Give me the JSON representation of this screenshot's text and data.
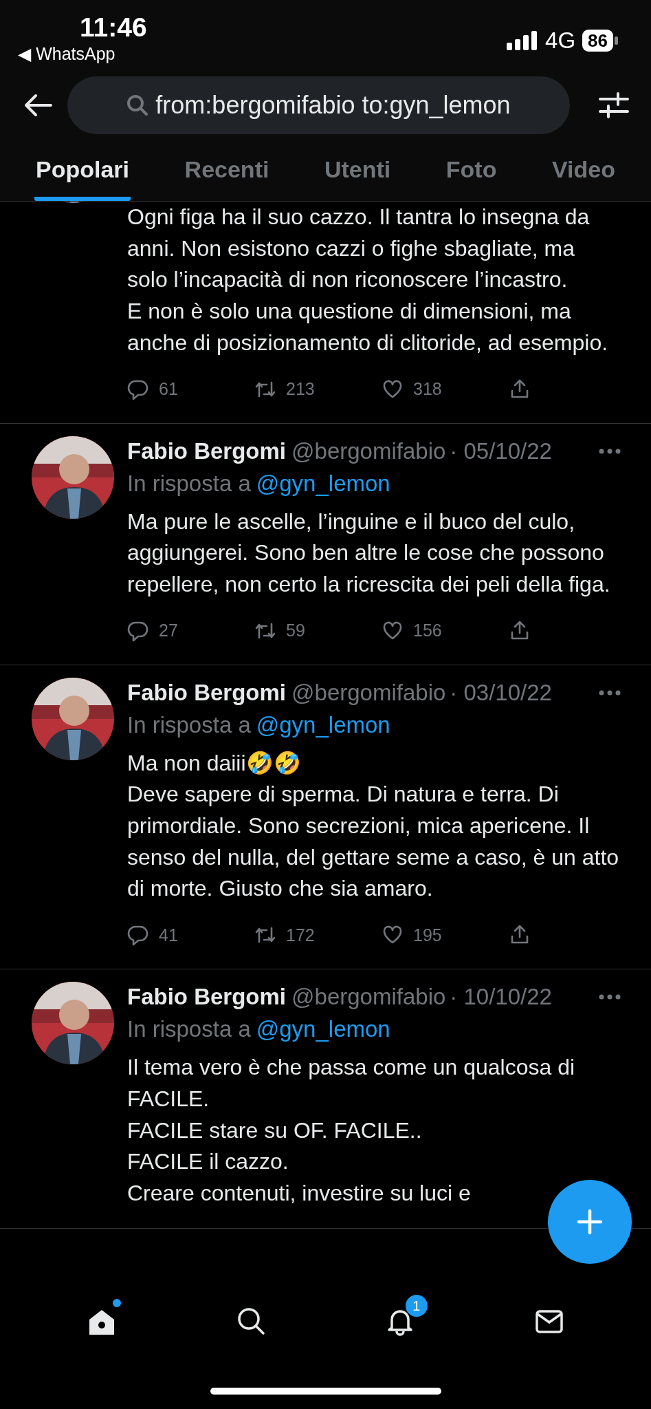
{
  "status_bar": {
    "time": "11:46",
    "back_label": "◀ WhatsApp",
    "network": "4G",
    "battery": "86"
  },
  "search": {
    "value": "from:bergomifabio to:gyn_lemon"
  },
  "tabs": [
    {
      "label": "Popolari",
      "selected": true
    },
    {
      "label": "Recenti",
      "selected": false
    },
    {
      "label": "Utenti",
      "selected": false
    },
    {
      "label": "Foto",
      "selected": false
    },
    {
      "label": "Video",
      "selected": false
    }
  ],
  "tweets": [
    {
      "text": "Ogni figa ha il suo cazzo. Il tantra lo insegna da anni. Non esistono cazzi o fighe sbagliate, ma solo l’incapacità di non riconoscere l’incastro.\nE non è solo una questione di dimensioni, ma anche di posizionamento di clitoride, ad esempio.",
      "replies": "61",
      "retweets": "213",
      "likes": "318"
    },
    {
      "name": "Fabio Bergomi",
      "handle": "@bergomifabio",
      "date": "· 05/10/22",
      "reply_label": "In risposta a",
      "reply_to": "@gyn_lemon",
      "text": "Ma pure le ascelle, l’inguine e il buco del culo, aggiungerei. Sono ben altre le cose che possono repellere, non certo la ricrescita dei peli della figa.",
      "replies": "27",
      "retweets": "59",
      "likes": "156"
    },
    {
      "name": "Fabio Bergomi",
      "handle": "@bergomifabio",
      "date": "· 03/10/22",
      "reply_label": "In risposta a",
      "reply_to": "@gyn_lemon",
      "text": "Ma non daiii🤣🤣\nDeve sapere di sperma. Di natura e terra. Di primordiale. Sono secrezioni, mica apericene. Il senso del nulla, del gettare seme a caso, è un atto di morte. Giusto che sia amaro.",
      "replies": "41",
      "retweets": "172",
      "likes": "195"
    },
    {
      "name": "Fabio Bergomi",
      "handle": "@bergomifabio",
      "date": "· 10/10/22",
      "reply_label": "In risposta a",
      "reply_to": "@gyn_lemon",
      "text": "Il tema vero è che passa come un qualcosa di FACILE.\nFACILE stare su OF. FACILE..\nFACILE il cazzo.\nCreare contenuti, investire su luci e"
    }
  ],
  "nav": [
    {
      "kind": "home",
      "selected": true,
      "dot": true
    },
    {
      "kind": "search",
      "selected": false,
      "dot": false
    },
    {
      "kind": "notifications",
      "selected": false,
      "dot": false,
      "badge": "1"
    },
    {
      "kind": "messages",
      "selected": false,
      "dot": false
    }
  ]
}
